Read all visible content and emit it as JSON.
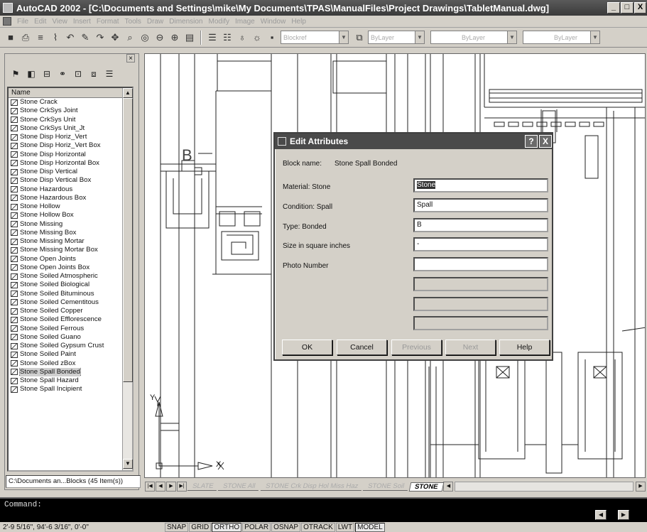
{
  "window": {
    "title": "AutoCAD 2002 - [C:\\Documents and Settings\\mike\\My Documents\\TPAS\\ManualFiles\\Project Drawings\\TabletManual.dwg]",
    "controls": {
      "minimize": "_",
      "maximize": "□",
      "close": "X"
    }
  },
  "menu": [
    "File",
    "Edit",
    "View",
    "Insert",
    "Format",
    "Tools",
    "Draw",
    "Dimension",
    "Modify",
    "Image",
    "Window",
    "Help"
  ],
  "toolbar": {
    "block_combo": "Blockref",
    "layer_combo": "ByLayer",
    "linetype_combo": "ByLayer",
    "lineweight_combo": "ByLayer"
  },
  "panel": {
    "list_header": "Name",
    "items": [
      "Stone Crack",
      "Stone CrkSys Joint",
      "Stone CrkSys Unit",
      "Stone CrkSys Unit_Jt",
      "Stone Disp Horiz_Vert",
      "Stone Disp Horiz_Vert Box",
      "Stone Disp Horizontal",
      "Stone Disp Horizontal Box",
      "Stone Disp Vertical",
      "Stone Disp Vertical Box",
      "Stone Hazardous",
      "Stone Hazardous Box",
      "Stone Hollow",
      "Stone Hollow Box",
      "Stone Missing",
      "Stone Missing Box",
      "Stone Missing Mortar",
      "Stone Missing Mortar Box",
      "Stone Open Joints",
      "Stone Open Joints Box",
      "Stone Soiled Atmospheric",
      "Stone Soiled Biological",
      "Stone Soiled Bituminous",
      "Stone Soiled Cementitous",
      "Stone Soiled Copper",
      "Stone Soiled Efflorescence",
      "Stone Soiled Ferrous",
      "Stone Soiled Guano",
      "Stone Soiled Gypsum Crust",
      "Stone Soiled Paint",
      "Stone Soiled zBox",
      "Stone Spall Bonded",
      "Stone Spall Hazard",
      "Stone Spall Incipient"
    ],
    "selected_index": 31,
    "status_path": "C:\\Documents an...Blocks (45 Item(s))"
  },
  "layout_tabs": [
    "SLATE",
    "STONE All",
    "STONE Crk Disp Hol Miss Haz",
    "STONE Soil",
    "STONE"
  ],
  "active_tab": "STONE",
  "dialog": {
    "title": "Edit Attributes",
    "block_name_label": "Block name:",
    "block_name_value": "Stone Spall Bonded",
    "attributes": [
      {
        "label": "Material: Stone",
        "value": "Stone"
      },
      {
        "label": "Condition: Spall",
        "value": "Spall"
      },
      {
        "label": "Type: Bonded",
        "value": "B"
      },
      {
        "label": "Size in square inches",
        "value": "-"
      },
      {
        "label": "Photo Number",
        "value": ""
      }
    ],
    "buttons": {
      "ok": "OK",
      "cancel": "Cancel",
      "previous": "Previous",
      "next": "Next",
      "help": "Help"
    },
    "help_glyph": "?",
    "close_glyph": "X"
  },
  "ucs": {
    "y": "Y",
    "x": "X"
  },
  "drawing_labels": {
    "b": "B"
  },
  "command": {
    "prompt": "Command:"
  },
  "status": {
    "coordinates": "2'-9 5/16\",  94'-6 3/16\", 0'-0\"",
    "toggles": [
      "SNAP",
      "GRID",
      "ORTHO",
      "POLAR",
      "OSNAP",
      "OTRACK",
      "LWT",
      "MODEL"
    ],
    "active_toggles": [
      "ORTHO",
      "MODEL"
    ]
  }
}
